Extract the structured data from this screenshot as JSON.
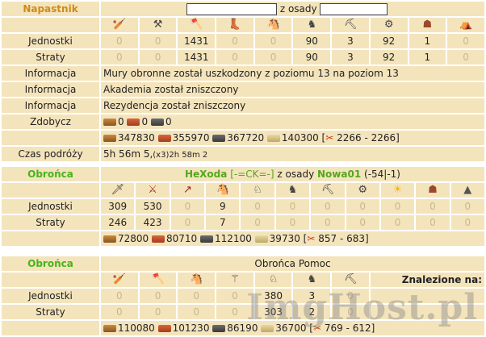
{
  "attacker": {
    "header": "Napastnik",
    "from_label": "z osady",
    "rows": [
      {
        "label": "Jednostki",
        "values": [
          "0",
          "0",
          "1431",
          "0",
          "0",
          "90",
          "3",
          "92",
          "1",
          "0"
        ]
      },
      {
        "label": "Straty",
        "values": [
          "0",
          "0",
          "1431",
          "0",
          "0",
          "90",
          "3",
          "92",
          "1",
          "0"
        ]
      }
    ],
    "info_label": "Informacja",
    "info": [
      "Mury obronne został uszkodzony z poziomu 13 na poziom 13",
      "Akademia został zniszczony",
      "Rezydencja został zniszczony"
    ],
    "loot_label": "Zdobycz",
    "loot": [
      "0",
      "0",
      "0"
    ],
    "resources": [
      "347830",
      "355970",
      "367720",
      "140300"
    ],
    "cp": "2266 - 2266",
    "travel_label": "Czas podróży",
    "travel_time": "5h 56m 5,",
    "travel_extra": "(x3)2h 58m 2",
    "icons": [
      "club-icon",
      "axe-light-icon",
      "axe-icon",
      "boot-icon",
      "horse-icon",
      "armored-horse-icon",
      "ram-icon",
      "catapult-icon",
      "chief-icon",
      "settler-icon"
    ]
  },
  "defender1": {
    "header": "Obrońca",
    "player": "HeXoda",
    "alliance": "[-=CK=-]",
    "from_label": "z osady",
    "village": "Nowa01",
    "coords": "(-54|-1)",
    "rows": [
      {
        "label": "Jednostki",
        "values": [
          "309",
          "530",
          "0",
          "9",
          "0",
          "0",
          "0",
          "0",
          "0",
          "0",
          "0"
        ]
      },
      {
        "label": "Straty",
        "values": [
          "246",
          "423",
          "0",
          "7",
          "0",
          "0",
          "0",
          "0",
          "0",
          "0",
          "0"
        ]
      }
    ],
    "resources": [
      "72800",
      "80710",
      "112100",
      "39730"
    ],
    "cp": "857 - 683",
    "icons": [
      "sword-icon",
      "sword2-icon",
      "spear-icon",
      "horse-icon",
      "horse2-icon",
      "horse3-icon",
      "ram-icon",
      "catapult-icon",
      "sun-icon",
      "chief-icon",
      "hat-icon"
    ]
  },
  "defender2": {
    "header": "Obrońca",
    "title": "Obrońca Pomoc",
    "found_label": "Znalezione na:",
    "rows": [
      {
        "label": "Jednostki",
        "values": [
          "0",
          "0",
          "0",
          "0",
          "380",
          "3",
          "0"
        ]
      },
      {
        "label": "Straty",
        "values": [
          "0",
          "0",
          "0",
          "0",
          "303",
          "2",
          "0"
        ]
      }
    ],
    "resources": [
      "110080",
      "101230",
      "86190",
      "36700"
    ],
    "cp": "769 - 612",
    "icons": [
      "club-icon",
      "axe-icon",
      "horse-icon",
      "staff-icon",
      "horse2-icon",
      "horse3-icon",
      "ram-icon"
    ]
  },
  "watermark": "ImgHost.pl",
  "colors": {
    "cell_bg": "#f4e4bc",
    "zero": "#c8b890",
    "attacker": "#d08a1a",
    "defender": "#46b51a"
  }
}
